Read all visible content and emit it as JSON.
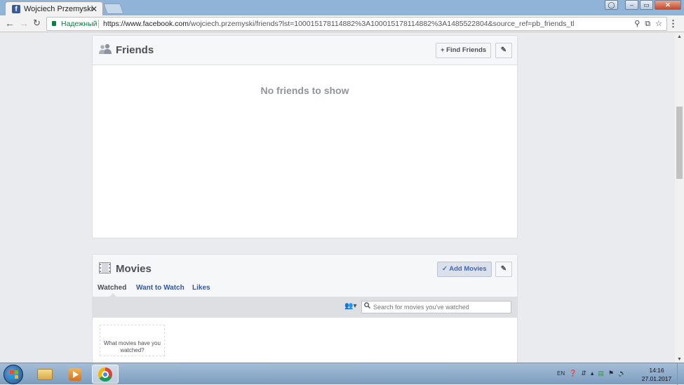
{
  "browser": {
    "tab_title": "Wojciech Przemyski",
    "tab_close": "✕",
    "secure_label": "Надежный",
    "url_domain": "https://www.facebook.com",
    "url_path": "/wojciech.przemyski/friends?lst=100015178114882%3A100015178114882%3A1485522804&source_ref=pb_friends_tl"
  },
  "friends": {
    "title": "Friends",
    "find_friends_label": "+ Find Friends",
    "empty_text": "No friends to show"
  },
  "movies": {
    "title": "Movies",
    "add_movies_label": "✓ Add Movies",
    "tabs": [
      {
        "label": "Watched"
      },
      {
        "label": "Want to Watch"
      },
      {
        "label": "Likes"
      }
    ],
    "search_placeholder": "Search for movies you've watched",
    "prompt_text": "What movies have you watched?"
  },
  "taskbar": {
    "language": "EN",
    "time": "14:16",
    "date": "27.01.2017"
  },
  "icons": {
    "friends": "friends-icon",
    "movies": "film-icon",
    "pencil": "pencil-icon",
    "search": "search-icon"
  }
}
